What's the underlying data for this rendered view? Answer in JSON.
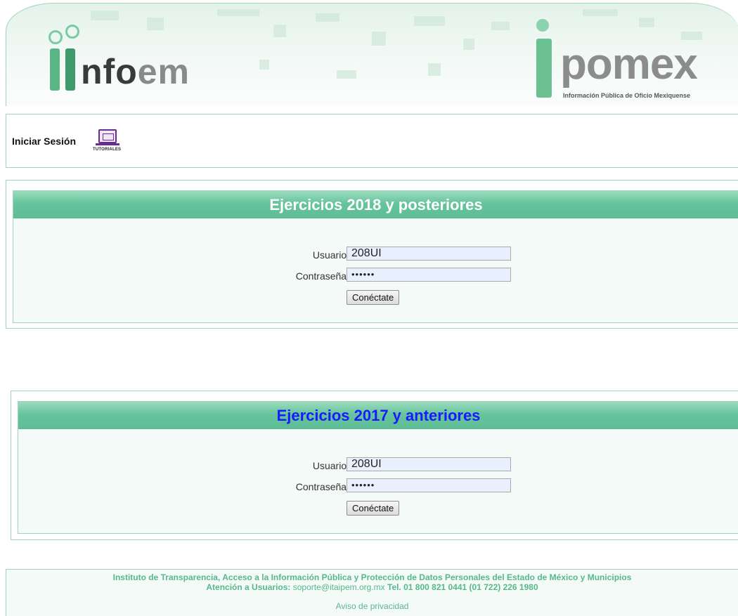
{
  "header": {
    "left_logo_text_dark": "nfo",
    "left_logo_text_light": "em",
    "right_logo_text": "pomex",
    "right_logo_subtitle": "Información Pública de Oficio Mexiquense"
  },
  "login_bar": {
    "label": "Iniciar Sesión",
    "tutorials_label": "TUTORIALES"
  },
  "panels": [
    {
      "title": "Ejercicios 2018 y posteriores",
      "title_color": "#ffffff",
      "user_label": "Usuario:",
      "user_value": "208UI",
      "password_label": "Contraseña:",
      "password_value": "••••••",
      "button_label": "Conéctate"
    },
    {
      "title": "Ejercicios 2017 y anteriores",
      "title_color": "#1a1aff",
      "user_label": "Usuario:",
      "user_value": "208UI",
      "password_label": "Contraseña:",
      "password_value": "••••••",
      "button_label": "Conéctate"
    }
  ],
  "footer": {
    "institute": "Instituto de Transparencia, Acceso a la Información Pública y Protección de Datos Personales del Estado de México y Municipios",
    "support_prefix": "Atención a Usuarios:",
    "support_email": "soporte@itaipem.org.mx",
    "support_phone": "Tel. 01 800 821 0441 (01 722) 226 1980",
    "privacy": "Aviso de privacidad"
  },
  "colors": {
    "accent_green": "#5dbd94",
    "border_green": "#9fd3bb",
    "footer_text": "#58b78d"
  }
}
